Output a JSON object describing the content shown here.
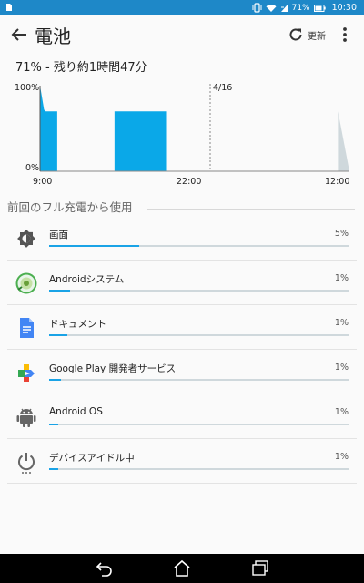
{
  "status_bar": {
    "battery_percent": "71%",
    "time": "10:30",
    "icons": [
      "notification-icon",
      "vibrate-icon",
      "wifi-icon",
      "signal-icon",
      "battery-icon"
    ]
  },
  "app_bar": {
    "title": "電池",
    "refresh_label": "更新"
  },
  "summary": "71% - 残り約1時間47分",
  "chart_data": {
    "type": "area",
    "y_tick_labels": [
      "100%",
      "0%"
    ],
    "x_tick_labels": [
      "9:00",
      "22:00",
      "12:00"
    ],
    "annotations": [
      "4/16"
    ],
    "series": [
      {
        "color": "#0aa8e8",
        "segments": [
          {
            "x": [
              9.0,
              9.1,
              9.2,
              9.35,
              9.5,
              10.5
            ],
            "y": [
              100,
              92,
              84,
              72,
              70,
              70
            ]
          },
          {
            "x": [
              15.5,
              20.0
            ],
            "y": [
              70,
              70
            ]
          }
        ]
      },
      {
        "color": "#cfd8dc",
        "segments": [
          {
            "x": [
              35.0,
              36.0
            ],
            "y": [
              70,
              0
            ]
          }
        ]
      }
    ]
  },
  "usage_section": {
    "header": "前回のフル充電から使用",
    "items": [
      {
        "name": "画面",
        "percent_label": "5%",
        "fraction": 0.3,
        "icon": "brightness-icon"
      },
      {
        "name": "Androidシステム",
        "percent_label": "1%",
        "fraction": 0.07,
        "icon": "android-system-icon"
      },
      {
        "name": "ドキュメント",
        "percent_label": "1%",
        "fraction": 0.06,
        "icon": "docs-icon"
      },
      {
        "name": "Google Play 開発者サービス",
        "percent_label": "1%",
        "fraction": 0.04,
        "icon": "play-services-icon"
      },
      {
        "name": "Android OS",
        "percent_label": "1%",
        "fraction": 0.03,
        "icon": "android-os-icon"
      },
      {
        "name": "デバイスアイドル中",
        "percent_label": "1%",
        "fraction": 0.03,
        "icon": "power-icon"
      }
    ]
  },
  "nav_bar": [
    "back-icon",
    "home-icon",
    "recents-icon"
  ]
}
